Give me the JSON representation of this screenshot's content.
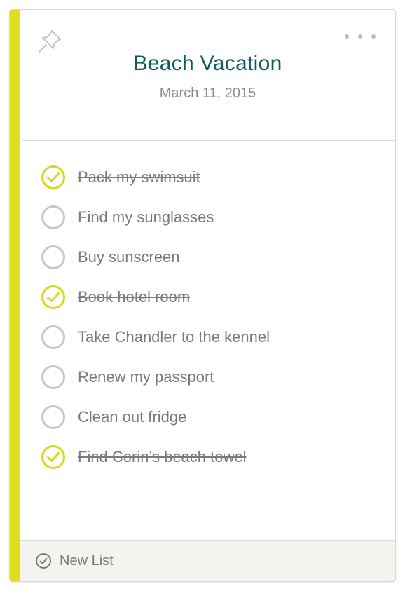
{
  "list": {
    "title": "Beach Vacation",
    "date": "March 11, 2015",
    "items": [
      {
        "label": "Pack my swimsuit",
        "done": true
      },
      {
        "label": "Find my sunglasses",
        "done": false
      },
      {
        "label": "Buy sunscreen",
        "done": false
      },
      {
        "label": "Book hotel room",
        "done": true
      },
      {
        "label": "Take Chandler to the kennel",
        "done": false
      },
      {
        "label": "Renew my passport",
        "done": false
      },
      {
        "label": "Clean out fridge",
        "done": false
      },
      {
        "label": "Find Corin’s beach towel",
        "done": true
      }
    ]
  },
  "header": {
    "pin_icon": "pin-icon",
    "more_icon": "more-options-icon"
  },
  "footer": {
    "new_list_label": "New List",
    "icon": "check-circle-icon"
  },
  "colors": {
    "accent": "#dde01a",
    "title": "#0f5b57",
    "check_done": "#d6da1c",
    "check_empty": "#c9c7bf",
    "icon_gray": "#bdbdbd"
  }
}
